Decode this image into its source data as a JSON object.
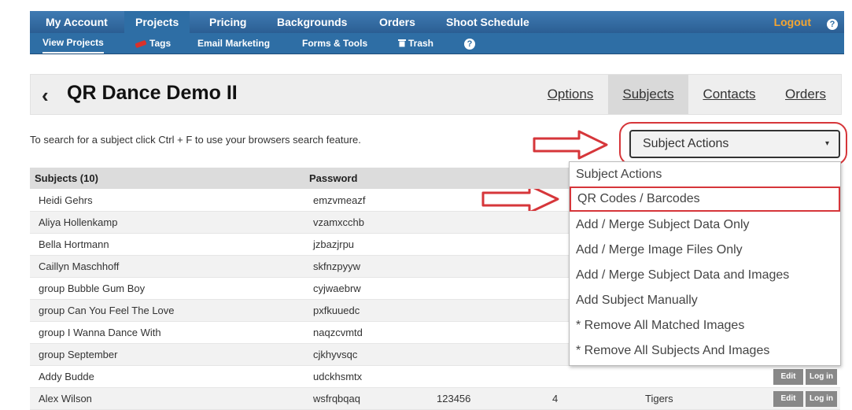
{
  "nav": {
    "items": [
      "My Account",
      "Projects",
      "Pricing",
      "Backgrounds",
      "Orders",
      "Shoot Schedule"
    ],
    "logout": "Logout",
    "help_glyph": "?"
  },
  "subnav": {
    "items": [
      "View Projects",
      "Tags",
      "Email Marketing",
      "Forms & Tools",
      "Trash"
    ],
    "trash_icon": "trash-icon",
    "help_glyph": "?"
  },
  "project": {
    "back": "‹",
    "title": "QR Dance Demo II",
    "tabs": [
      "Options",
      "Subjects",
      "Contacts",
      "Orders"
    ]
  },
  "search_hint": "To search for a subject click Ctrl + F to use your browsers search feature.",
  "subject_actions": {
    "selected": "Subject Actions",
    "caret": "▾",
    "options": [
      "Subject Actions",
      "QR Codes / Barcodes",
      "Add / Merge Subject Data Only",
      "Add / Merge Image Files Only",
      "Add / Merge Subject Data and Images",
      "Add Subject Manually",
      "* Remove All Matched Images",
      "* Remove All Subjects And Images"
    ]
  },
  "table": {
    "headers": [
      "Subjects (10)",
      "Password"
    ],
    "rows": [
      {
        "name": "Heidi Gehrs",
        "password": "emzvmeazf"
      },
      {
        "name": "Aliya Hollenkamp",
        "password": "vzamxcchb"
      },
      {
        "name": "Bella Hortmann",
        "password": "jzbazjrpu"
      },
      {
        "name": "Caillyn Maschhoff",
        "password": "skfnzpyyw"
      },
      {
        "name": "group Bubble Gum Boy",
        "password": "cyjwaebrw"
      },
      {
        "name": "group Can You Feel The Love",
        "password": "pxfkuuedc"
      },
      {
        "name": "group I Wanna Dance With",
        "password": "naqzcvmtd"
      },
      {
        "name": "group September",
        "password": "cjkhyvsqc"
      },
      {
        "name": "Addy Budde",
        "password": "udckhsmtx"
      },
      {
        "name": "Alex Wilson",
        "password": "wsfrqbqaq",
        "col3": "123456",
        "col4": "4",
        "col5": "Tigers"
      }
    ],
    "edit_label": "Edit",
    "login_label": "Log in"
  },
  "colors": {
    "nav_blue": "#2e6ea5",
    "annotation_red": "#d6363a",
    "logout_orange": "#f4a531"
  }
}
